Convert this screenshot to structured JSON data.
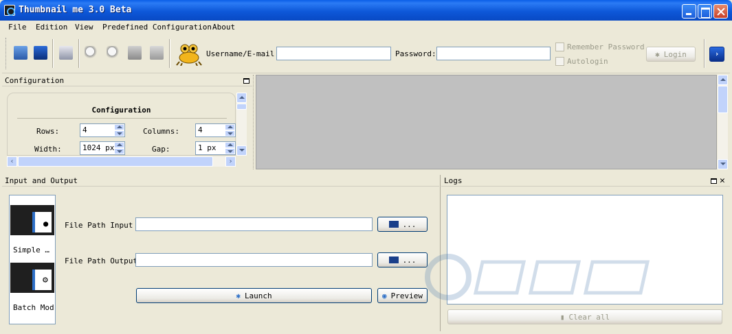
{
  "window": {
    "title": "Thumbnail me 3.0 Beta"
  },
  "menu": [
    "File",
    "Edition",
    "View",
    "Predefined Configuration",
    "About"
  ],
  "toolbar": {
    "icons": [
      "settings-icon",
      "load-icon",
      "save-icon",
      "zoom-in-icon",
      "zoom-out-icon",
      "trash-icon",
      "upload-icon"
    ],
    "username_label": "Username/E-mail:",
    "username_value": "",
    "password_label": "Password:",
    "password_value": "",
    "remember_label": "Remember Password",
    "autologin_label": "Autologin",
    "login_label": "Login"
  },
  "configuration": {
    "panel_title": "Configuration",
    "heading": "Configuration",
    "rows_label": "Rows:",
    "rows_value": "4",
    "columns_label": "Columns:",
    "columns_value": "4",
    "width_label": "Width:",
    "width_value": "1024 px",
    "gap_label": "Gap:",
    "gap_value": "1 px"
  },
  "io": {
    "panel_title": "Input and Output",
    "modes": [
      "Simple …",
      "Batch Mod"
    ],
    "input_label": "File Path Input",
    "output_label": "File Path Output",
    "browse_label": "...",
    "launch_label": "Launch",
    "preview_label": "Preview"
  },
  "logs": {
    "panel_title": "Logs",
    "clear_label": "Clear all"
  },
  "colors": {
    "title_bar": "#0A5FE8",
    "window_bg": "#ECE9D8",
    "preview_area": "#C0C0C0",
    "accent": "#2d6fc7"
  }
}
